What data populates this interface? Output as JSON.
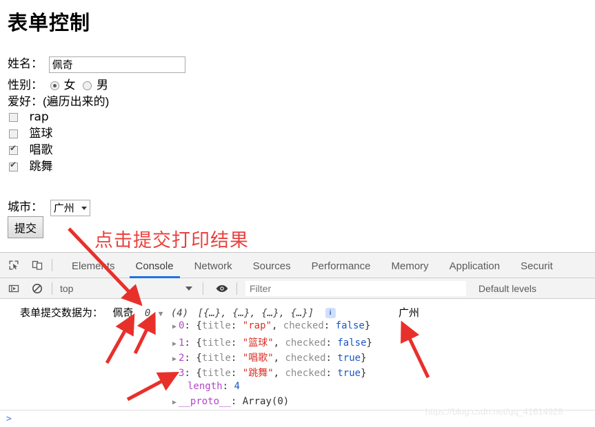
{
  "page": {
    "title": "表单控制",
    "name_label": "姓名：",
    "name_value": "佩奇",
    "gender_label": "性别：",
    "gender_options": [
      {
        "label": "女",
        "checked": true
      },
      {
        "label": "男",
        "checked": false
      }
    ],
    "hobby_label": "爱好：(遍历出来的)",
    "hobbies": [
      {
        "label": "rap",
        "checked": false
      },
      {
        "label": "篮球",
        "checked": false
      },
      {
        "label": "唱歌",
        "checked": true
      },
      {
        "label": "跳舞",
        "checked": true
      }
    ],
    "city_label": "城市：",
    "city_value": "广州",
    "submit_label": "提交",
    "annotation": "点击提交打印结果"
  },
  "devtools": {
    "icons": {
      "inspect": "inspect-element-icon",
      "device": "device-toolbar-icon",
      "sidebar": "console-sidebar-icon",
      "clear": "clear-console-icon",
      "eye": "live-expression-eye-icon"
    },
    "tabs": [
      {
        "label": "Elements",
        "active": false
      },
      {
        "label": "Console",
        "active": true
      },
      {
        "label": "Network",
        "active": false
      },
      {
        "label": "Sources",
        "active": false
      },
      {
        "label": "Performance",
        "active": false
      },
      {
        "label": "Memory",
        "active": false
      },
      {
        "label": "Application",
        "active": false
      },
      {
        "label": "Securit",
        "active": false
      }
    ],
    "filter_bar": {
      "context": "top",
      "filter_placeholder": "Filter",
      "filter_value": "",
      "levels": "Default levels"
    },
    "active_tab_color": "#1a73e8"
  },
  "console": {
    "message_prefix": "表单提交数据为：",
    "name_logged": "佩奇",
    "gender_index": "0",
    "array_summary_count": "(4)",
    "array_summary_body": "[{…}, {…}, {…}, {…}]",
    "city_logged": "广州",
    "array_rows": [
      {
        "index": "0",
        "title": "\"rap\"",
        "checked": "false"
      },
      {
        "index": "1",
        "title": "\"篮球\"",
        "checked": "false"
      },
      {
        "index": "2",
        "title": "\"唱歌\"",
        "checked": "true"
      },
      {
        "index": "3",
        "title": "\"跳舞\"",
        "checked": "true"
      }
    ],
    "length_key": "length",
    "length_value": "4",
    "proto_key": "__proto__",
    "proto_value": "Array(0)",
    "prompt": ">"
  },
  "watermark": "https://blog.csdn.net/qq_41614928",
  "annotation_color": "#e8433f"
}
